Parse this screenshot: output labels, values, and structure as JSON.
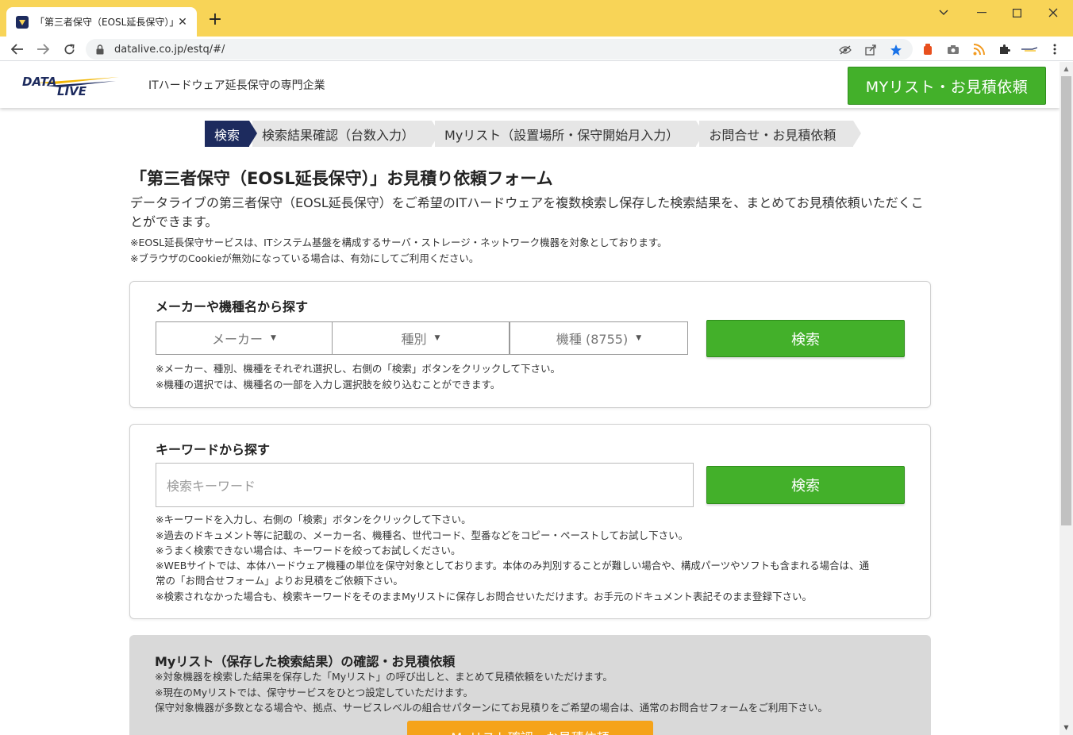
{
  "browser": {
    "tab_title": "「第三者保守（EOSL延長保守）」お",
    "tab_close": "✕",
    "new_tab": "+",
    "url": "datalive.co.jp/estq/#/",
    "window_controls": {
      "chevron": "⌄",
      "minimize": "—",
      "maximize": "☐",
      "close": "✕"
    }
  },
  "header": {
    "logo_text_top": "DATA",
    "logo_text_bottom": "LIVE",
    "tagline": "ITハードウェア延長保守の専門企業",
    "mylist_button": "MYリスト・お見積依頼"
  },
  "steps": [
    {
      "label": "検索",
      "active": true
    },
    {
      "label": "検索結果確認（台数入力）",
      "active": false
    },
    {
      "label": "Myリスト（設置場所・保守開始月入力）",
      "active": false
    },
    {
      "label": "お問合せ・お見積依頼",
      "active": false
    }
  ],
  "intro": {
    "title": "「第三者保守（EOSL延長保守）」お見積り依頼フォーム",
    "lead": "データライブの第三者保守（EOSL延長保守）をご希望のITハードウェアを複数検索し保存した検索結果を、まとめてお見積依頼いただくことができます。",
    "notes": [
      "※EOSL延長保守サービスは、ITシステム基盤を構成するサーバ・ストレージ・ネットワーク機器を対象としております。",
      "※ブラウザのCookieが無効になっている場合は、有効にしてご利用ください。"
    ]
  },
  "maker_search": {
    "title": "メーカーや機種名から探す",
    "selects": [
      "メーカー",
      "種別",
      "機種 (8755)"
    ],
    "button": "検索",
    "notes": [
      "※メーカー、種別、機種をそれぞれ選択し、右側の「検索」ボタンをクリックして下さい。",
      "※機種の選択では、機種名の一部を入力し選択肢を絞り込むことができます。"
    ]
  },
  "keyword_search": {
    "title": "キーワードから探す",
    "placeholder": "検索キーワード",
    "button": "検索",
    "notes": [
      "※キーワードを入力し、右側の「検索」ボタンをクリックして下さい。",
      "※過去のドキュメント等に記載の、メーカー名、機種名、世代コード、型番などをコピー・ペーストしてお試し下さい。",
      "※うまく検索できない場合は、キーワードを絞ってお試しください。",
      "※WEBサイトでは、本体ハードウェア機種の単位を保守対象としております。本体のみ判別することが難しい場合や、構成パーツやソフトも含まれる場合は、通",
      "常の「お問合せフォーム」よりお見積をご依頼下さい。",
      "※検索されなかった場合も、検索キーワードをそのままMyリストに保存しお問合せいただけます。お手元のドキュメント表記そのまま登録下さい。"
    ]
  },
  "mylist_section": {
    "title": "Myリスト（保存した検索結果）の確認・お見積依頼",
    "notes": [
      "※対象機器を検索した結果を保存した「Myリスト」の呼び出しと、まとめて見積依頼をいただけます。",
      "※現在のMyリストでは、保守サービスをひとつ設定していただけます。",
      "保守対象機器が多数となる場合や、拠点、サービスレベルの組合せパターンにてお見積りをご希望の場合は、通常のお問合せフォームをご利用下さい。"
    ],
    "button": "Myリスト確認・お見積依頼"
  },
  "colors": {
    "chrome_titlebar": "#f8d457",
    "brand_navy": "#1d2b5e",
    "green_button": "#43b02a",
    "orange_button": "#f5a31a",
    "gray_panel": "#d9d9d9"
  },
  "icons": [
    "datalive-favicon",
    "back-arrow-icon",
    "forward-arrow-icon",
    "reload-icon",
    "lock-icon",
    "eye-off-icon",
    "share-icon",
    "star-icon",
    "extension-icon",
    "camera-icon",
    "rss-icon",
    "puzzle-icon",
    "menu-dots-icon"
  ]
}
